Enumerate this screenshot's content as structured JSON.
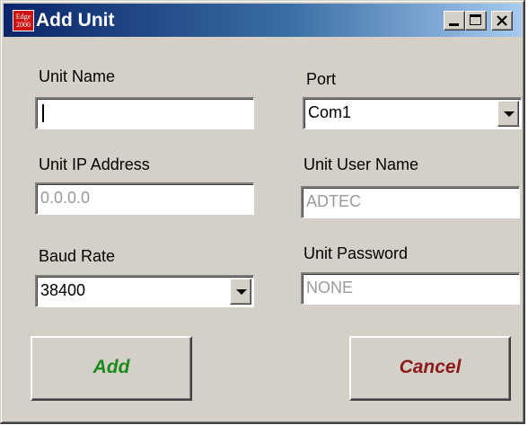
{
  "window": {
    "title": "Add Unit",
    "icon_lines": [
      "Edge",
      "2000"
    ],
    "icon_color": "#d01010",
    "titlebar_color": "#0a246a"
  },
  "form": {
    "unit_name": {
      "label": "Unit Name",
      "value": ""
    },
    "port": {
      "label": "Port",
      "selected": "Com1"
    },
    "unit_ip": {
      "label": "Unit IP Address",
      "value": "0.0.0.0"
    },
    "unit_user": {
      "label": "Unit User Name",
      "value": "ADTEC"
    },
    "baud_rate": {
      "label": "Baud Rate",
      "selected": "38400"
    },
    "unit_password": {
      "label": "Unit Password",
      "value": "NONE"
    }
  },
  "buttons": {
    "add": {
      "label": "Add",
      "color": "#1a8a1a"
    },
    "cancel": {
      "label": "Cancel",
      "color": "#8b1a1a"
    }
  },
  "icons": [
    "minimize-icon",
    "maximize-icon",
    "close-icon",
    "chevron-down-icon"
  ]
}
